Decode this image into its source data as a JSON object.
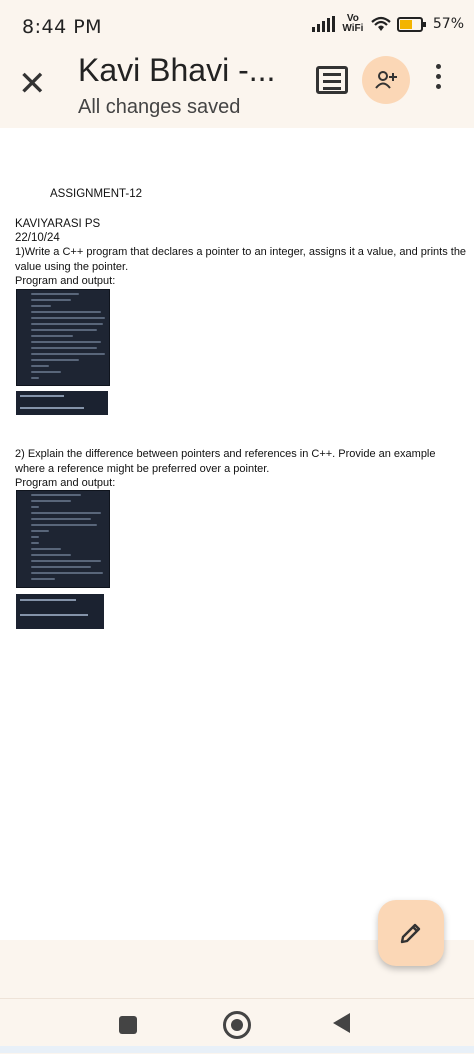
{
  "status": {
    "time": "8:44 PM",
    "network": "Vo WiFi",
    "battery": "57%",
    "battery_level": 0.57
  },
  "header": {
    "title": "Kavi Bhavi -...",
    "subtitle": "All changes saved"
  },
  "icons": {
    "close": "close-icon",
    "comment": "comment-icon",
    "share": "add-person-icon",
    "more": "more-vert-icon",
    "edit": "pencil-icon"
  },
  "document": {
    "heading": "ASSIGNMENT-12",
    "author": "KAVIYARASI PS",
    "date": "22/10/24",
    "q1_line1": "1)Write a C++ program that declares a pointer to an integer, assigns it a value, and prints the",
    "q1_line2": "value using the pointer.",
    "q1_label": " Program and output:",
    "q2_line1": "2)  Explain the difference between pointers and references in C++. Provide an example",
    "q2_line2": "where a reference might be preferred over a pointer.",
    "q2_label": "Program and output:"
  },
  "colors": {
    "header_bg": "#fbf5ee",
    "accent": "#fbd7b6",
    "code_bg": "#1e2533"
  }
}
